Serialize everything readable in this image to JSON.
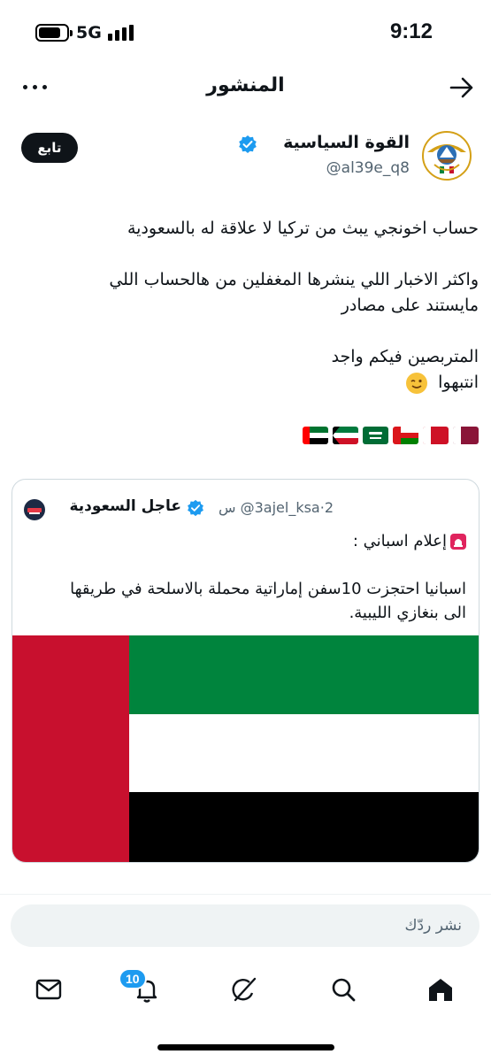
{
  "status": {
    "network": "5G",
    "time": "9:12"
  },
  "header": {
    "title": "المنشور",
    "more_icon": "more-dots-icon",
    "back_icon": "arrow-right-icon"
  },
  "post": {
    "author_name": "القوة السياسية",
    "author_handle": "@al39e_q8",
    "follow_label": "تابع",
    "lines": [
      "حساب اخونجي يبث من تركيا لا علاقة له بالسعودية",
      "",
      "واكثر الاخبار اللي ينشرها المغفلين من هالحساب اللي",
      "مايستند على مصادر",
      "",
      "المتربصين فيكم واجد",
      "انتبهوا"
    ],
    "flags": [
      "qatar",
      "bahrain",
      "oman",
      "saudi-arabia",
      "kuwait",
      "uae"
    ]
  },
  "quote": {
    "name": "عاجل السعودية",
    "handle": "@3ajel_ksa",
    "separator": "·",
    "time": "2 س",
    "line1": "إعلام اسباني :",
    "line2": "اسبانيا احتجزت 10سفن إماراتية محملة بالاسلحة في طريقها",
    "line3": "الى بنغازي الليبية."
  },
  "reply": {
    "placeholder": "نشر ردّك"
  },
  "nav": {
    "notifications_badge": "10"
  },
  "colors": {
    "accent": "#1d9bf0",
    "text": "#0f1419",
    "muted": "#536471",
    "uae_red": "#c8102e",
    "uae_green": "#00843d"
  }
}
